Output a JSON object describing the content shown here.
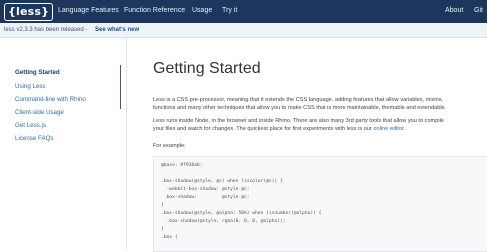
{
  "nav": {
    "logo": "{less}",
    "links": [
      "Language Features",
      "Function Reference",
      "Usage",
      "Try it"
    ],
    "right_links": [
      "About",
      "Git"
    ]
  },
  "announcement": {
    "text": "less v2.3.3 has been released -",
    "link": "See what's new"
  },
  "sidebar": {
    "items": [
      {
        "label": "Getting Started",
        "active": true
      },
      {
        "label": "Using Less",
        "active": false
      },
      {
        "label": "Command-line with Rhino",
        "active": false
      },
      {
        "label": "Client-side Usage",
        "active": false
      },
      {
        "label": "Get Less.js",
        "active": false
      },
      {
        "label": "License FAQs",
        "active": false
      }
    ]
  },
  "content": {
    "title": "Getting Started",
    "para1_line1": "Less is a CSS pre-processor, meaning that it extends the CSS language, adding features that allow variables, mixins,",
    "para1_line2": "functions and many other techniques that allow you to make CSS that is more maintainable, themable and extendable.",
    "para2_line1": "Less runs inside Node, in the browser and inside Rhino. There are also many 3rd party tools that allow you to compile",
    "para2_line2": "your files and watch for changes. The quickest place for first experiments with less is our",
    "para2_link": "online editor.",
    "example_label": "For example:",
    "code_lines": [
      "@base: #f938ab;",
      "",
      ".box-shadow(@style, @c) when (iscolor(@c)) {",
      "  -webkit-box-shadow: @style @c;",
      "  box-shadow:         @style @c;",
      "}",
      ".box-shadow(@style, @alpha: 50%) when (isnumber(@alpha)) {",
      "  .box-shadow(@style, rgba(0, 0, 0, @alpha));",
      "}",
      ".box {"
    ]
  },
  "colors": {
    "navbar": "#1d365d",
    "link": "#2f6ea8",
    "code_bg": "#f7f8fa"
  }
}
